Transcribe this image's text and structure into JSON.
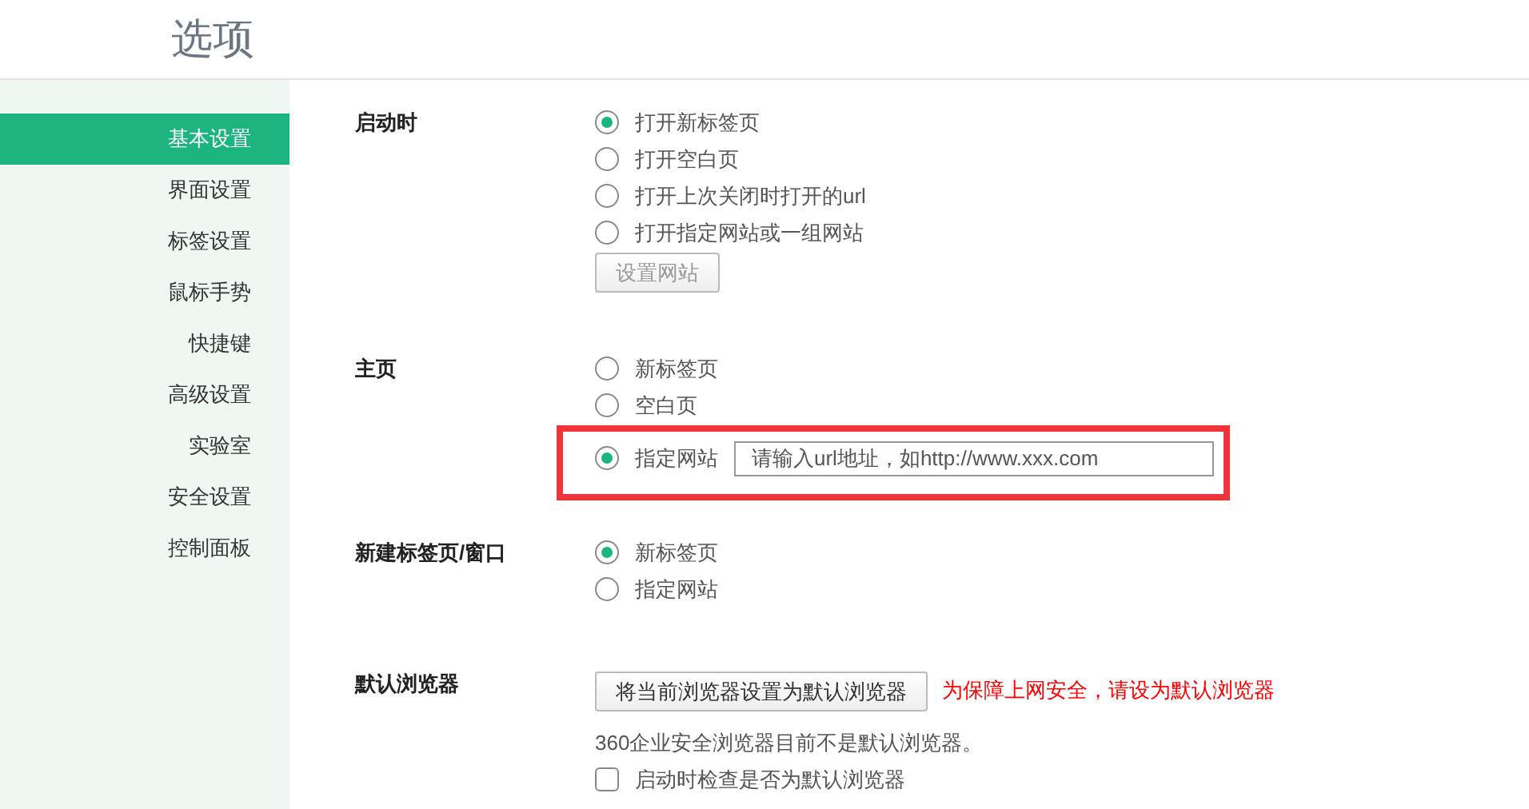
{
  "window": {
    "title": "选项"
  },
  "sidebar": {
    "items": [
      {
        "label": "基本设置",
        "selected": true
      },
      {
        "label": "界面设置",
        "selected": false
      },
      {
        "label": "标签设置",
        "selected": false
      },
      {
        "label": "鼠标手势",
        "selected": false
      },
      {
        "label": "快捷键",
        "selected": false
      },
      {
        "label": "高级设置",
        "selected": false
      },
      {
        "label": "实验室",
        "selected": false
      },
      {
        "label": "安全设置",
        "selected": false
      },
      {
        "label": "控制面板",
        "selected": false
      }
    ]
  },
  "sections": [
    {
      "label": "启动时",
      "controls": [
        {
          "kind": "radio",
          "label": "打开新标签页",
          "selected": true
        },
        {
          "kind": "radio",
          "label": "打开空白页",
          "selected": false
        },
        {
          "kind": "radio",
          "label": "打开上次关闭时打开的url",
          "selected": false
        },
        {
          "kind": "radio",
          "label": "打开指定网站或一组网站",
          "selected": false
        },
        {
          "kind": "button",
          "label": "设置网站",
          "disabled": true
        }
      ]
    },
    {
      "label": "主页",
      "controls": [
        {
          "kind": "radio",
          "label": "新标签页",
          "selected": false
        },
        {
          "kind": "radio",
          "label": "空白页",
          "selected": false
        },
        {
          "kind": "radio",
          "label": "指定网站",
          "selected": true,
          "highlighted": true,
          "field": {
            "placeholder": "请输入url地址，如http://www.xxx.com"
          }
        }
      ]
    },
    {
      "label": "新建标签页/窗口",
      "controls": [
        {
          "kind": "radio",
          "label": "新标签页",
          "selected": true
        },
        {
          "kind": "radio",
          "label": "指定网站",
          "selected": false
        }
      ]
    },
    {
      "label": "默认浏览器",
      "controls": [
        {
          "kind": "button",
          "label": "将当前浏览器设置为默认浏览器",
          "disabled": false,
          "note": "为保障上网安全，请设为默认浏览器"
        },
        {
          "kind": "text",
          "text": "360企业安全浏览器目前不是默认浏览器。"
        },
        {
          "kind": "checkbox",
          "label": "启动时检查是否为默认浏览器",
          "checked": false
        }
      ]
    }
  ]
}
